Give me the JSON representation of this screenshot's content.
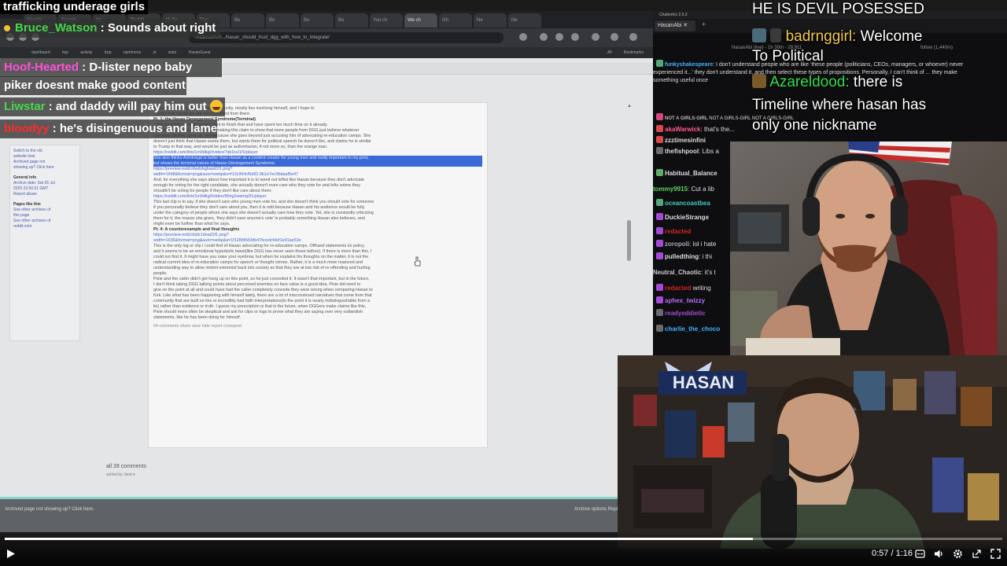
{
  "chat_overlay": {
    "title": "trafficking underage girls",
    "lines": [
      {
        "user": "Bruce_Watson",
        "sep": " : ",
        "text": "Sounds about right",
        "color": "#43d94a"
      },
      {
        "user": "Hoof-Hearted",
        "sep": " : ",
        "text": "D-lister nepo baby",
        "color": "#ff4fd8"
      },
      {
        "user": "",
        "sep": "",
        "text": "piker doesnt make good content",
        "color": "#ffffff"
      },
      {
        "user": "Liwstar",
        "sep": " : ",
        "text": "and daddy will pay him out",
        "color": "#43d94a"
      },
      {
        "user": "bloodyy",
        "sep": " : ",
        "text": "he's disingenuous and lame",
        "color": "#ff2a2a"
      }
    ]
  },
  "browser": {
    "tabs": [
      "Google",
      "Google",
      "trp",
      "Reddit",
      "15 De",
      "Rep",
      "Bo",
      "Bo",
      "Bo",
      "Bo",
      "You ch",
      "We ch",
      "Gh",
      "Ne",
      "Ne"
    ],
    "active_tab": 11,
    "url": "reddit.com/r/.../hasan_should_trust_dgg_with_how_to_integrate/",
    "bookmarks": "dashboard  twp  activity  trpp  npmforms  yt  stats  HasanGuest",
    "all_bookmarks": "All Bookmarks",
    "sidebar": {
      "links": [
        "Switch to the old",
        "website look",
        "",
        "Archived page not",
        "showing up? Click here"
      ],
      "general_head": "General info",
      "general": [
        "Archive date: Sat 26 Jul",
        "2025 23:50:31 GMT",
        "Report abuse"
      ],
      "pages_head": "Pages like this",
      "pages": [
        "See other archives of",
        "this page",
        "See other archives of",
        "reddit.com"
      ]
    },
    "article": {
      "lines": [
        {
          "t": "...more lies that come from this community, mostly lies involving himself, and I hope to",
          "k": ""
        },
        {
          "t": "...ways that narratives are reconstructed from there.",
          "k": ""
        },
        {
          "t": "Pt. 1: the Hasan Derangement Syndrome(Terminal)",
          "k": "h"
        },
        {
          "t": "...his unconstructive because I want to finish that and have spent too much time on it already.",
          "k": ""
        },
        {
          "t": "I wanted to include the clip of her making this claim to show that more people from DGG just believe whatever",
          "k": ""
        },
        {
          "t": "narrative Destiny spins up, and because she goes beyond just accusing him of advocating re-education camps. She",
          "k": ""
        },
        {
          "t": "doesn't just think that Hasan wants them, but wants them for political speech he doesn't like, and claims he is similar",
          "k": ""
        },
        {
          "t": "to Trump in that way, and would be just as authoritarian, if not more so, than the orange man.",
          "k": ""
        },
        {
          "t": "https://reddit.com/link/1m9dkg0/video/7qk1ks/1f1/player",
          "k": "link"
        },
        {
          "t": "She also thinks Aominegd is better than Hasan as a content creator for young men and really important to my post,",
          "k": "hl"
        },
        {
          "t": "but shows the terminal nature of Hasan Derangement Syndrome.",
          "k": "hl"
        },
        {
          "t": "https://preview.redd.it/wdzkgbazd1f1.png?",
          "k": "link"
        },
        {
          "t": "width=1648&format=png&auto=webp&s=f13c9fcfcf5d92.9b1e7ec3bdaaf5e47",
          "k": "link"
        },
        {
          "t": "And, for everything she says about how important it is to weed out leftist like Hasan because they don't advocate",
          "k": ""
        },
        {
          "t": "enough for voting for the right candidate, she actually doesn't even care who they vote for and lefts voters they",
          "k": ""
        },
        {
          "t": "shouldn't be voting for people if they don't like care about them:",
          "k": ""
        },
        {
          "t": "https://reddit.com/link/1m9dkg0/video/9hhg2wamq2f1/player",
          "k": "link"
        },
        {
          "t": "This last clip is to say, if she doesn't care who young men vote for, and she doesn't think you should vote for someone",
          "k": ""
        },
        {
          "t": "if you personally believe they don't care about you, then it is odd because Hasan and his audience would be fully",
          "k": ""
        },
        {
          "t": "under the category of people whom she says she doesn't actually care how they vote. Yet, she is constantly criticizing",
          "k": ""
        },
        {
          "t": "them for it, the reason she gives, 'they didn't earn anyone's vote' is probably something Hasan also believes, and",
          "k": ""
        },
        {
          "t": "might even be further than what he says.",
          "k": ""
        },
        {
          "t": "Pt. 4: A counterexample and final thoughts",
          "k": "h"
        },
        {
          "t": "https://preview.redd.it/afz1dnad1f1.png?",
          "k": "link"
        },
        {
          "t": "width=1636&format=png&auto=webp&s=1f128bf0d3db47bcedcf4ef1e91ae53e",
          "k": "link"
        },
        {
          "t": "This is the only log or clip I could find of Hasan advocating for re-education camps. Offhand statements i/o policy,",
          "k": ""
        },
        {
          "t": "and it seems to be an emotional hyperbolic tweet(like DGG has never seen those before). If there is more than this, I",
          "k": ""
        },
        {
          "t": "could not find it. It might have you raise your eyebrow, but when he explains his thoughts on the matter, it is not the",
          "k": ""
        },
        {
          "t": "radical current idea of re-education camps for speech or thought crimes. Rather, it is a much more nuanced and",
          "k": ""
        },
        {
          "t": "understanding way to allow violent extremist back into society as that they are at low risk of re-offending and hurting",
          "k": ""
        },
        {
          "t": "people.",
          "k": ""
        },
        {
          "t": "Pixie and the caller didn't get hung up on this point, so he just conceded it. It wasn't that important, but in the future,",
          "k": ""
        },
        {
          "t": "I don't think taking DGG talking points about perceived enemies on face value is a good idea. Pixie did need to",
          "k": ""
        },
        {
          "t": "give on the point at all and could have had the caller completely concede they were wrong when comparing Hasan to",
          "k": ""
        },
        {
          "t": "Kirk. Like what has been happening with himself lately, there are a lot of misconstrued narratives that come from that",
          "k": ""
        },
        {
          "t": "community that are built on lies or incredibly bad faith interpretations(to the point it is nearly indistinguishable from a",
          "k": ""
        },
        {
          "t": "lie) rather than evidence or truth. I guess my prescription is that in the future, when DGGers make claims like this,",
          "k": ""
        },
        {
          "t": "Pixie should more often be skeptical and ask for clips or logs to prove what they are saying over very outlandish",
          "k": ""
        },
        {
          "t": "statements, like he has been doing for himself.",
          "k": ""
        }
      ],
      "footer": "64 comments   share   save   hide   report   crosspost"
    },
    "comments_count": "all 28 comments",
    "sorted_by": "sorted by:  best ▾",
    "footer_left": "Archived page not showing up? Click here.",
    "footer_right": "Archive options Reply"
  },
  "twitch": {
    "head": "Chatterino 2.5.3",
    "tab": "HasanAbi",
    "sub": "HasanAbi (live) - 1h 30m - 28,811",
    "follow": "follow (1,440m)",
    "lines": [
      {
        "user": "funkyshakespeare",
        "text": ": I don't understand people who are like 'these people (politicians, CEOs, managers, or whoever) never experienced it...' they don't understand it, and then select these types of propositions. Personally, I can't think of ... they make something useful once",
        "color": "#3fb3ff",
        "badge": "#53a87a"
      },
      {
        "user": "NOT A GIRLS-GIRL",
        "text": " NOT A GIRLS-GIRL NOT A GIRLS-GIRL",
        "color": "#bbb",
        "badge": "#d4497a"
      },
      {
        "user": "akaWarwick",
        "text": ": that's the...",
        "color": "#ff5c8a",
        "badge": "#d84a4a"
      },
      {
        "user": "zzztimesinfini",
        "text": "",
        "color": "#dddddd",
        "badge": "#d84a4a"
      },
      {
        "user": "thefishpool",
        "text": ": Libs a",
        "color": "#dddddd",
        "badge": "#6a6a6a"
      },
      {
        "user": "Habitual_Balance",
        "text": "",
        "color": "#dddddd",
        "badge": "#5fae6a"
      },
      {
        "user": "tommy9915",
        "text": ": Cut a lib",
        "color": "#5bd15a",
        "badge": ""
      },
      {
        "user": "oceancoastbea",
        "text": "",
        "color": "#3fd0c5",
        "badge": "#53a87a"
      },
      {
        "user": "DuckieStrange",
        "text": "",
        "color": "#dddddd",
        "badge": "#a34ad4"
      },
      {
        "user": "redacted",
        "text": "",
        "color": "#d32525",
        "badge": "#a34ad4"
      },
      {
        "user": "zoropoli",
        "text": ": lol i hate",
        "color": "#aaaaaa",
        "badge": "#a34ad4"
      },
      {
        "user": "pulledthing",
        "text": ": i thi",
        "color": "#dddddd",
        "badge": "#a34ad4"
      },
      {
        "user": "Neutral_Chaotic",
        "text": ": it's t",
        "color": "#cccccc",
        "badge": ""
      },
      {
        "user": "redacted",
        "text": " writing",
        "color": "#d32525",
        "badge": "#a34ad4"
      },
      {
        "user": "aphex_twizzy",
        "text": "",
        "color": "#b76bff",
        "badge": "#a34ad4"
      },
      {
        "user": "readyeddietic",
        "text": "",
        "color": "#a34ad4",
        "badge": "#6a6a6a"
      },
      {
        "user": "charlie_the_choco",
        "text": "",
        "color": "#3fb3ff",
        "badge": "#6a6a6a"
      }
    ]
  },
  "right_overlay": {
    "lines": [
      {
        "user": "",
        "text": "HE IS DEVIL POSESSED",
        "color": "#ffffff"
      },
      {
        "user": "badrnggirl:",
        "text": "  Welcome",
        "color": "#f3c94a"
      },
      {
        "user": "",
        "text": "To Political",
        "color": "#ffffff"
      },
      {
        "user": "Azareldood:",
        "text": " there is",
        "color": "#2fe04a"
      },
      {
        "user": "",
        "text": "Timeline where hasan has",
        "color": "#ffffff"
      },
      {
        "user": "",
        "text": "only one nickname",
        "color": "#ffffff"
      }
    ]
  },
  "webcam2": {
    "banner": "HASAN"
  },
  "player": {
    "time_current": "0:57",
    "time_total": "1:16",
    "time_text": "0:57 / 1:16",
    "progress": 0.75
  },
  "colors": {
    "browser_dark": "#202124",
    "page_bg": "#e4e5e7",
    "highlight": "#3b6ad8",
    "footer_accent": "#86d6c8",
    "twitch_bg": "#0e0e10"
  }
}
